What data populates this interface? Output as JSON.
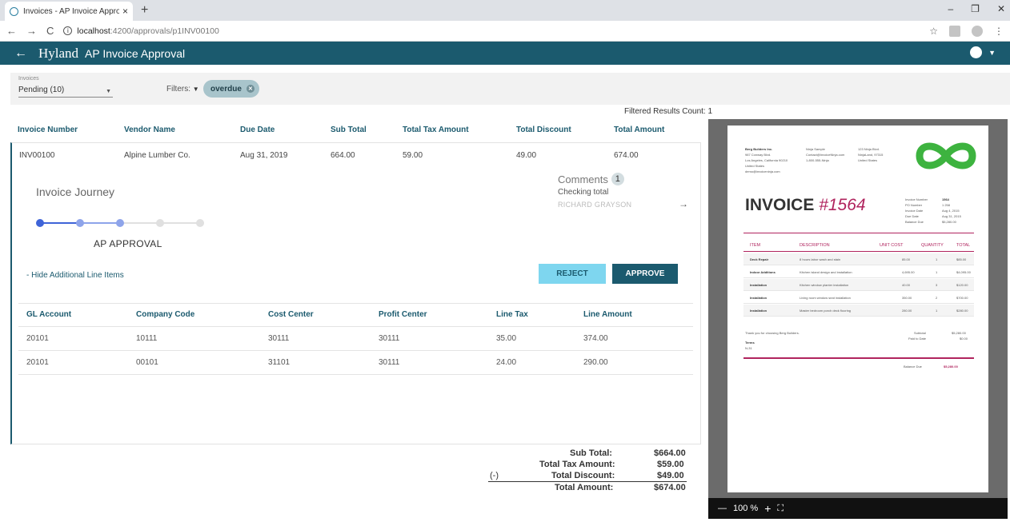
{
  "browser": {
    "tab_title": "Invoices - AP Invoice Approval A",
    "tab_close": "×",
    "new_tab": "+",
    "url_host": "localhost",
    "url_path": ":4200/approvals/p1INV00100",
    "back": "←",
    "forward": "→",
    "reload": "C",
    "win_min": "–",
    "win_max": "❐",
    "win_close": "✕",
    "star": "☆",
    "menu": "⋮"
  },
  "app": {
    "back": "←",
    "brand": "Hyland",
    "title": "AP Invoice Approval"
  },
  "filters": {
    "dropdown_label": "Invoices",
    "dropdown_value": "Pending (10)",
    "filters_label": "Filters:",
    "filter_icon": "▼",
    "chip": "overdue",
    "chip_close": "✕",
    "count_text": "Filtered Results Count: 1"
  },
  "invoice_headers": [
    "Invoice Number",
    "Vendor Name",
    "Due Date",
    "Sub Total",
    "Total Tax Amount",
    "Total Discount",
    "Total Amount"
  ],
  "invoice_row": [
    "INV00100",
    "Alpine Lumber Co.",
    "Aug 31, 2019",
    "664.00",
    "59.00",
    "49.00",
    "674.00"
  ],
  "journey": {
    "title": "Invoice Journey",
    "stage": "AP APPROVAL",
    "steps_total": 5,
    "steps_completed": 3
  },
  "comments": {
    "title": "Comments",
    "count": "1",
    "text": "Checking total",
    "author": "RICHARD GRAYSON",
    "arrow": "→"
  },
  "actions": {
    "hide_link": "- Hide Additional Line Items",
    "reject": "REJECT",
    "approve": "APPROVE"
  },
  "line_headers": [
    "GL Account",
    "Company Code",
    "Cost Center",
    "Profit Center",
    "Line Tax",
    "Line Amount"
  ],
  "line_rows": [
    [
      "20101",
      "10111",
      "30111",
      "30111",
      "35.00",
      "374.00"
    ],
    [
      "20101",
      "00101",
      "31101",
      "30111",
      "24.00",
      "290.00"
    ]
  ],
  "totals": {
    "sub_total_label": "Sub Total:",
    "sub_total": "$664.00",
    "tax_label": "Total Tax Amount:",
    "tax": "$59.00",
    "discount_prefix": "(-)",
    "discount_label": "Total Discount:",
    "discount": "$49.00",
    "total_label": "Total Amount:",
    "total": "$674.00"
  },
  "pdf": {
    "company": "Berg Builders Inc.",
    "address1": "987 Conway Blvd.",
    "address2": "Los Angeles, California 90210",
    "address3": "United States",
    "address4": "demo@invoiceninja.com",
    "client1": "Ninja Sample",
    "client2": "Contact@InvoiceNinja.com",
    "client3": "1-800-555-Ninja",
    "client_addr1": "123 Ninja Blvd.",
    "client_addr2": "NinjaLand, 97315",
    "client_addr3": "United States",
    "invoice_word": "INVOICE",
    "invoice_no": "#1564",
    "meta_labels": [
      "Invoice Number",
      "PO Number",
      "Invoice Date",
      "Due Date",
      "Balance Due"
    ],
    "meta_values": [
      "1564",
      "1 258",
      "Aug 4, 2015",
      "Aug 31, 2015",
      "$5,280.00"
    ],
    "cols": [
      "ITEM",
      "DESCRIPTION",
      "UNIT COST",
      "QUANTITY",
      "TOTAL"
    ],
    "items": [
      [
        "Deck Repair",
        "8 hours labor wash and stain",
        "85.00",
        "1",
        "$85.00"
      ],
      [
        "Indoor Additions",
        "Kitchen island design and installation",
        "4,695.00",
        "1",
        "$4,095.00"
      ],
      [
        "Installation",
        "Kitchen window planter installation",
        "40.00",
        "3",
        "$120.00"
      ],
      [
        "Installation",
        "Living room window seat installation",
        "350.00",
        "2",
        "$700.00"
      ],
      [
        "Installation",
        "Master bedroom porch deck flooring",
        "280.00",
        "1",
        "$280.00"
      ]
    ],
    "thanks": "Thank you for choosing Berg Builders.",
    "terms": "Terms",
    "terms_val": "N-31",
    "subtotal_label": "Subtotal",
    "subtotal_val": "$5,280.00",
    "paid_label": "Paid to Date",
    "paid_val": "$0.00",
    "balance_label": "Balance Due",
    "balance_val": "$5,280.00",
    "zoom_minus": "—",
    "zoom": "100 %",
    "zoom_plus": "+",
    "fullscreen": "⛶"
  },
  "colors": {
    "primary": "#1b5a6e",
    "accent": "#7ed6ef",
    "invoice_magenta": "#b0245e",
    "logo_green": "#3db33f"
  }
}
